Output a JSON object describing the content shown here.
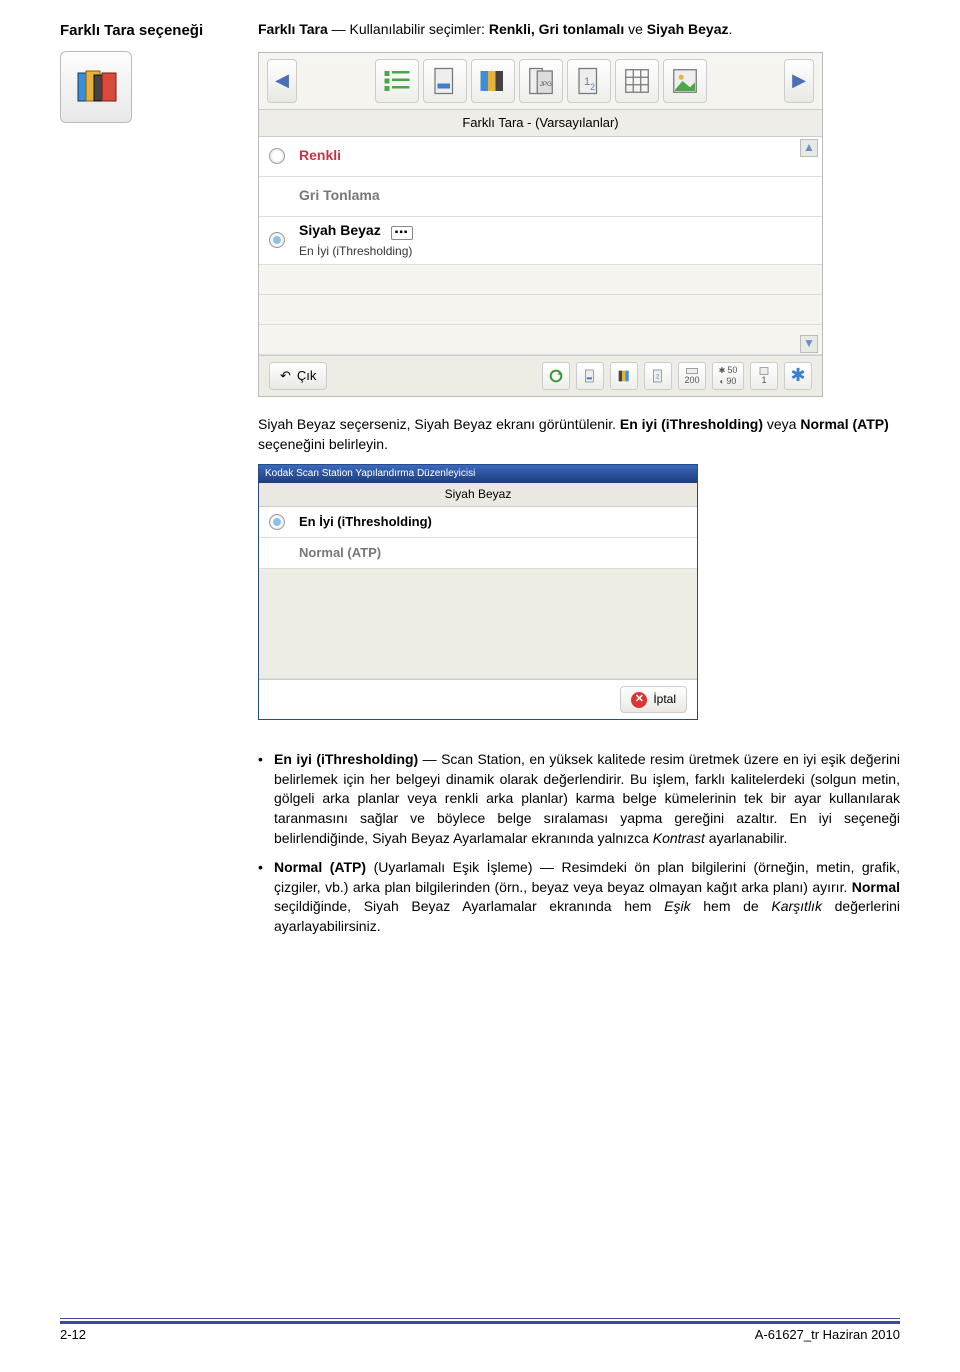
{
  "left_heading": "Farklı Tara seçeneği",
  "intro_prefix": "Farklı Tara",
  "intro_mid": " — Kullanılabilir seçimler: ",
  "intro_opts": "Renkli, Gri tonlamalı",
  "intro_and": " ve ",
  "intro_last": "Siyah Beyaz",
  "intro_end": ".",
  "panel1": {
    "title": "Farklı Tara - (Varsayılanlar)",
    "row_renkli": "Renkli",
    "row_gri": "Gri Tonlama",
    "row_sb": "Siyah Beyaz",
    "row_sb_sub": "En İyi (iThresholding)",
    "cik": "Çık",
    "mini_200": "200",
    "mini_50": "50",
    "mini_90": "90",
    "mini_1": "1"
  },
  "para2_a": "Siyah Beyaz seçerseniz, Siyah Beyaz ekranı görüntülenir. ",
  "para2_b_bold": "En iyi (iThresholding)",
  "para2_c": " veya ",
  "para2_d_bold": "Normal (ATP)",
  "para2_e": " seçeneğini belirleyin.",
  "panel2": {
    "winTitle": "Kodak Scan Station Yapılandırma Düzenleyicisi",
    "subTitle": "Siyah Beyaz",
    "row1": "En İyi (iThresholding)",
    "row2": "Normal (ATP)",
    "iptal": "İptal"
  },
  "bullet1": {
    "lead": "En iyi (iThresholding)",
    "body1": " — Scan Station, en yüksek kalitede resim üretmek üzere en iyi eşik değerini belirlemek için her belgeyi dinamik olarak değerlendirir. Bu işlem, farklı kalitelerdeki (solgun metin, gölgeli arka planlar veya renkli arka planlar) karma belge kümelerinin tek bir ayar kullanılarak taranmasını sağlar ve böylece belge sıralaması yapma gereğini azaltır. En iyi seçeneği belirlendiğinde, Siyah Beyaz Ayarlamalar ekranında yalnızca ",
    "ital1": "Kontrast",
    "body2": " ayarlanabilir."
  },
  "bullet2": {
    "lead": "Normal (ATP)",
    "body1": " (Uyarlamalı Eşik İşleme) — Resimdeki ön plan bilgilerini (örneğin, metin, grafik, çizgiler, vb.) arka plan bilgilerinden (örn., beyaz veya beyaz olmayan kağıt arka planı) ayırır. ",
    "bold2": "Normal",
    "body2": " seçildiğinde, Siyah Beyaz Ayarlamalar ekranında hem ",
    "ital1": "Eşik",
    "body3": " hem de ",
    "ital2": "Karşıtlık",
    "body4": " değerlerini ayarlayabilirsiniz."
  },
  "footer_left": "2-12",
  "footer_right": "A-61627_tr  Haziran 2010"
}
